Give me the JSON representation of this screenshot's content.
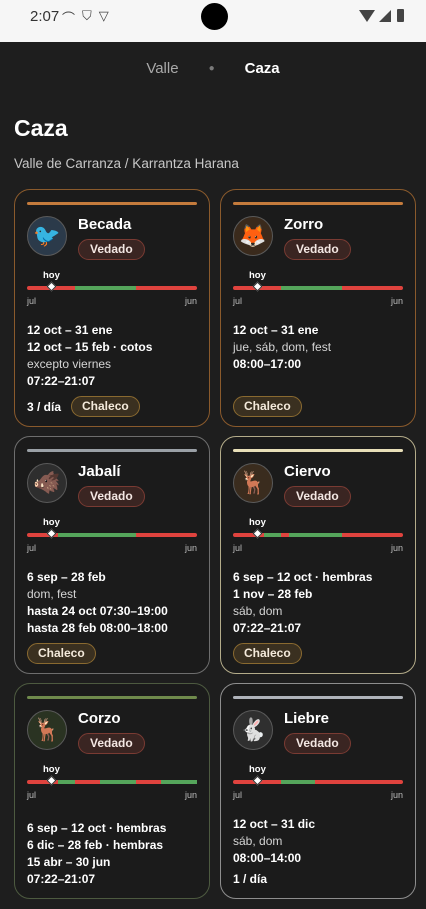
{
  "status": {
    "time": "2:07"
  },
  "tabs": [
    {
      "label": "Valle"
    },
    {
      "label": "Caza"
    }
  ],
  "page": {
    "title": "Caza",
    "subtitle": "Valle de Carranza / Karrantza Harana"
  },
  "common": {
    "hoy": "hoy",
    "axis_start": "jul",
    "axis_end": "jun",
    "status": "Vedado",
    "vest": "Chaleco"
  },
  "colors": {
    "open": "#55a55b",
    "closed": "#e0433e",
    "badge_bg": "#3a2522"
  },
  "cards": [
    {
      "name": "Becada",
      "icon": "bird-icon",
      "lines": [
        "12 oct – 31 ene",
        "12 oct – 15 feb · cotos",
        "excepto viernes",
        "07:22–21:07"
      ],
      "per_day": "3 / día",
      "vest": true
    },
    {
      "name": "Zorro",
      "icon": "fox-icon",
      "lines": [
        "12 oct – 31 ene",
        "jue, sáb, dom, fest",
        "08:00–17:00"
      ],
      "per_day": "",
      "vest": true
    },
    {
      "name": "Jabalí",
      "icon": "boar-icon",
      "lines": [
        "6 sep – 28 feb",
        "dom, fest",
        "hasta 24 oct 07:30–19:00",
        "hasta 28 feb 08:00–18:00"
      ],
      "per_day": "",
      "vest": true
    },
    {
      "name": "Ciervo",
      "icon": "deer-icon",
      "lines": [
        "6 sep – 12 oct · hembras",
        "1 nov – 28 feb",
        "sáb, dom",
        "07:22–21:07"
      ],
      "per_day": "",
      "vest": true
    },
    {
      "name": "Corzo",
      "icon": "roe-deer-icon",
      "lines": [
        "6 sep – 12 oct · hembras",
        "6 dic – 28 feb · hembras",
        "15 abr – 30 jun",
        "07:22–21:07"
      ],
      "per_day": "",
      "vest": false
    },
    {
      "name": "Liebre",
      "icon": "hare-icon",
      "lines": [
        "12 oct – 31 dic",
        "sáb, dom",
        "08:00–14:00"
      ],
      "per_day": "1 / día",
      "vest": false
    }
  ]
}
